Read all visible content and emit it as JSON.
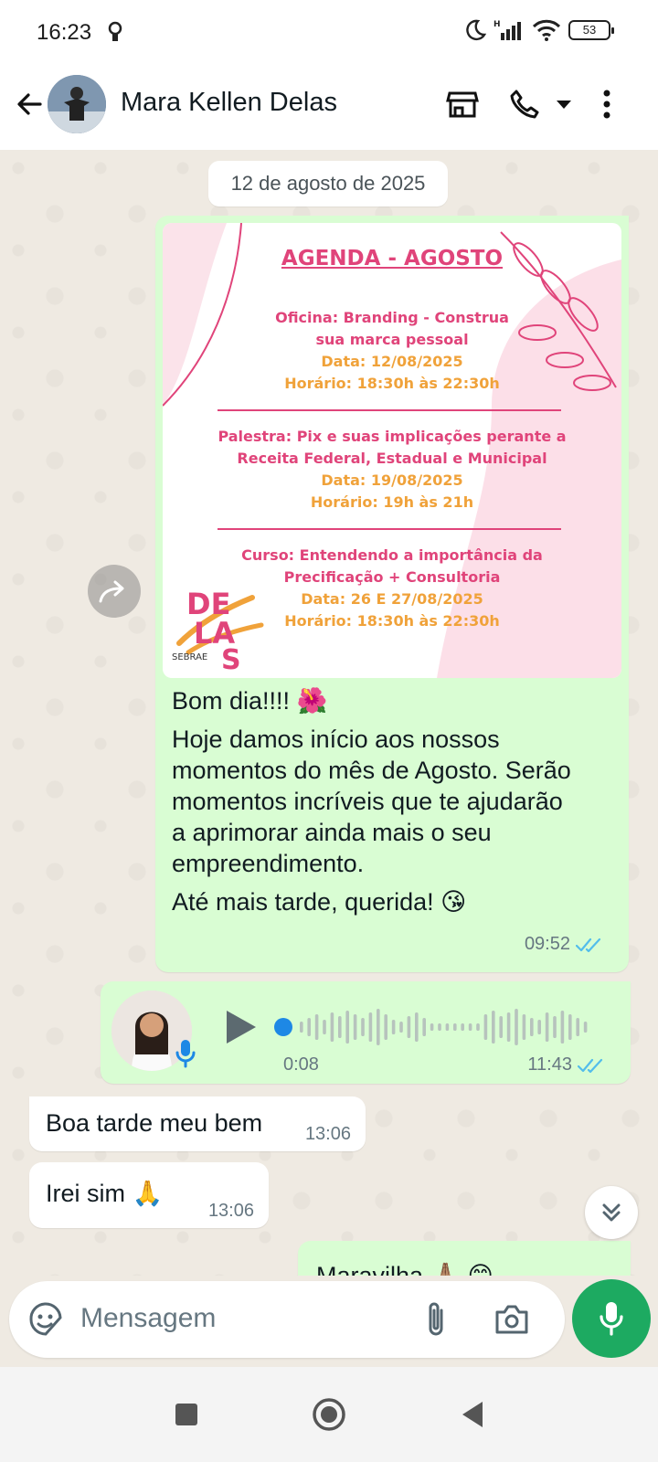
{
  "status_bar": {
    "time": "16:23",
    "battery": "53"
  },
  "header": {
    "contact_name": "Mara Kellen Delas"
  },
  "chat": {
    "date_chip": "12 de agosto de 2025",
    "messages": [
      {
        "image": {
          "title": "AGENDA - AGOSTO",
          "event1_line1": "Oficina: Branding - Construa",
          "event1_line2": "sua marca pessoal",
          "event1_date": "Data: 12/08/2025",
          "event1_time": "Horário: 18:30h às 22:30h",
          "event2_line1": "Palestra: Pix e suas implicações perante a",
          "event2_line2": "Receita Federal, Estadual e Municipal",
          "event2_date": "Data: 19/08/2025",
          "event2_time": "Horário: 19h às 21h",
          "event3_line1": "Curso: Entendendo a importância da",
          "event3_line2": "Precificação + Consultoria",
          "event3_date": "Data: 26 E 27/08/2025",
          "event3_time": "Horário: 18:30h às 22:30h",
          "logo_text": "DELAS",
          "logo_sub": "SEBRAE"
        },
        "line1": "Bom dia!!!! 🌺",
        "line2": "Hoje damos início aos nossos",
        "line3": "momentos do mês de Agosto. Serão",
        "line4": "momentos incríveis que te ajudarão",
        "line5": "a aprimorar ainda mais o seu",
        "line6": "empreendimento.",
        "line7": "Até mais tarde, querida! 😘",
        "time": "09:52"
      },
      {
        "voice_duration": "0:08",
        "time": "11:43"
      },
      {
        "text": "Boa tarde meu bem",
        "time": "13:06"
      },
      {
        "text": "Irei sim 🙏",
        "time": "13:06"
      },
      {
        "text": "Maravilha 🙏🏽 😊"
      }
    ]
  },
  "composer": {
    "placeholder": "Mensagem"
  },
  "colors": {
    "outgoing": "#d9fdd3",
    "incoming": "#ffffff",
    "accent": "#1daa61",
    "tick_read": "#53bdeb"
  },
  "icons": [
    "alarm-icon",
    "moon-icon",
    "signal-icon",
    "wifi-icon",
    "back-arrow-icon",
    "store-icon",
    "phone-icon",
    "dropdown-icon",
    "more-vert-icon",
    "forward-icon",
    "play-icon",
    "mic-icon",
    "double-check-icon",
    "chevrons-down-icon",
    "sticker-icon",
    "paperclip-icon",
    "camera-icon",
    "nav-square-icon",
    "nav-home-icon",
    "nav-back-icon"
  ]
}
